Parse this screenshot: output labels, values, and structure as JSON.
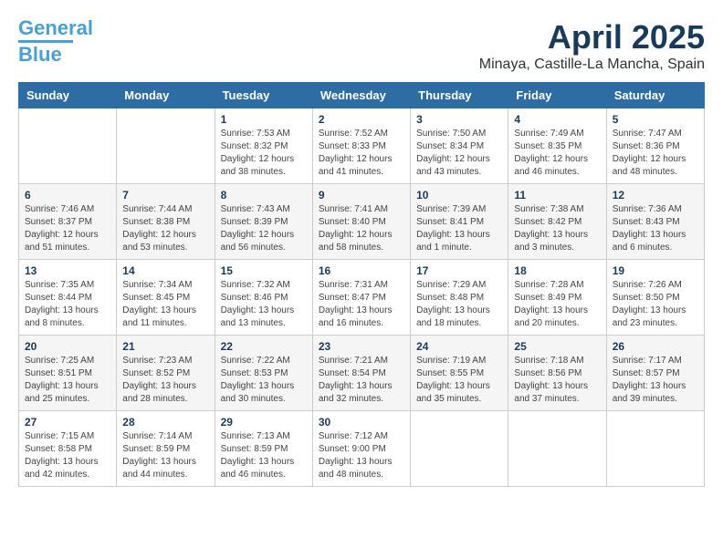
{
  "header": {
    "logo_line1": "General",
    "logo_line2": "Blue",
    "month_title": "April 2025",
    "location": "Minaya, Castille-La Mancha, Spain"
  },
  "days_of_week": [
    "Sunday",
    "Monday",
    "Tuesday",
    "Wednesday",
    "Thursday",
    "Friday",
    "Saturday"
  ],
  "weeks": [
    [
      {
        "day": "",
        "details": ""
      },
      {
        "day": "",
        "details": ""
      },
      {
        "day": "1",
        "details": "Sunrise: 7:53 AM\nSunset: 8:32 PM\nDaylight: 12 hours and 38 minutes."
      },
      {
        "day": "2",
        "details": "Sunrise: 7:52 AM\nSunset: 8:33 PM\nDaylight: 12 hours and 41 minutes."
      },
      {
        "day": "3",
        "details": "Sunrise: 7:50 AM\nSunset: 8:34 PM\nDaylight: 12 hours and 43 minutes."
      },
      {
        "day": "4",
        "details": "Sunrise: 7:49 AM\nSunset: 8:35 PM\nDaylight: 12 hours and 46 minutes."
      },
      {
        "day": "5",
        "details": "Sunrise: 7:47 AM\nSunset: 8:36 PM\nDaylight: 12 hours and 48 minutes."
      }
    ],
    [
      {
        "day": "6",
        "details": "Sunrise: 7:46 AM\nSunset: 8:37 PM\nDaylight: 12 hours and 51 minutes."
      },
      {
        "day": "7",
        "details": "Sunrise: 7:44 AM\nSunset: 8:38 PM\nDaylight: 12 hours and 53 minutes."
      },
      {
        "day": "8",
        "details": "Sunrise: 7:43 AM\nSunset: 8:39 PM\nDaylight: 12 hours and 56 minutes."
      },
      {
        "day": "9",
        "details": "Sunrise: 7:41 AM\nSunset: 8:40 PM\nDaylight: 12 hours and 58 minutes."
      },
      {
        "day": "10",
        "details": "Sunrise: 7:39 AM\nSunset: 8:41 PM\nDaylight: 13 hours and 1 minute."
      },
      {
        "day": "11",
        "details": "Sunrise: 7:38 AM\nSunset: 8:42 PM\nDaylight: 13 hours and 3 minutes."
      },
      {
        "day": "12",
        "details": "Sunrise: 7:36 AM\nSunset: 8:43 PM\nDaylight: 13 hours and 6 minutes."
      }
    ],
    [
      {
        "day": "13",
        "details": "Sunrise: 7:35 AM\nSunset: 8:44 PM\nDaylight: 13 hours and 8 minutes."
      },
      {
        "day": "14",
        "details": "Sunrise: 7:34 AM\nSunset: 8:45 PM\nDaylight: 13 hours and 11 minutes."
      },
      {
        "day": "15",
        "details": "Sunrise: 7:32 AM\nSunset: 8:46 PM\nDaylight: 13 hours and 13 minutes."
      },
      {
        "day": "16",
        "details": "Sunrise: 7:31 AM\nSunset: 8:47 PM\nDaylight: 13 hours and 16 minutes."
      },
      {
        "day": "17",
        "details": "Sunrise: 7:29 AM\nSunset: 8:48 PM\nDaylight: 13 hours and 18 minutes."
      },
      {
        "day": "18",
        "details": "Sunrise: 7:28 AM\nSunset: 8:49 PM\nDaylight: 13 hours and 20 minutes."
      },
      {
        "day": "19",
        "details": "Sunrise: 7:26 AM\nSunset: 8:50 PM\nDaylight: 13 hours and 23 minutes."
      }
    ],
    [
      {
        "day": "20",
        "details": "Sunrise: 7:25 AM\nSunset: 8:51 PM\nDaylight: 13 hours and 25 minutes."
      },
      {
        "day": "21",
        "details": "Sunrise: 7:23 AM\nSunset: 8:52 PM\nDaylight: 13 hours and 28 minutes."
      },
      {
        "day": "22",
        "details": "Sunrise: 7:22 AM\nSunset: 8:53 PM\nDaylight: 13 hours and 30 minutes."
      },
      {
        "day": "23",
        "details": "Sunrise: 7:21 AM\nSunset: 8:54 PM\nDaylight: 13 hours and 32 minutes."
      },
      {
        "day": "24",
        "details": "Sunrise: 7:19 AM\nSunset: 8:55 PM\nDaylight: 13 hours and 35 minutes."
      },
      {
        "day": "25",
        "details": "Sunrise: 7:18 AM\nSunset: 8:56 PM\nDaylight: 13 hours and 37 minutes."
      },
      {
        "day": "26",
        "details": "Sunrise: 7:17 AM\nSunset: 8:57 PM\nDaylight: 13 hours and 39 minutes."
      }
    ],
    [
      {
        "day": "27",
        "details": "Sunrise: 7:15 AM\nSunset: 8:58 PM\nDaylight: 13 hours and 42 minutes."
      },
      {
        "day": "28",
        "details": "Sunrise: 7:14 AM\nSunset: 8:59 PM\nDaylight: 13 hours and 44 minutes."
      },
      {
        "day": "29",
        "details": "Sunrise: 7:13 AM\nSunset: 8:59 PM\nDaylight: 13 hours and 46 minutes."
      },
      {
        "day": "30",
        "details": "Sunrise: 7:12 AM\nSunset: 9:00 PM\nDaylight: 13 hours and 48 minutes."
      },
      {
        "day": "",
        "details": ""
      },
      {
        "day": "",
        "details": ""
      },
      {
        "day": "",
        "details": ""
      }
    ]
  ]
}
